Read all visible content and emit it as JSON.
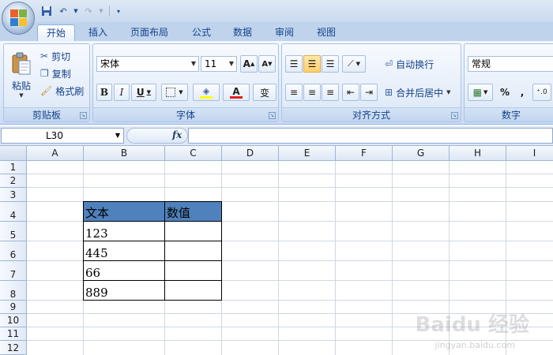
{
  "tabs": [
    "开始",
    "插入",
    "页面布局",
    "公式",
    "数据",
    "审阅",
    "视图"
  ],
  "clipboard": {
    "paste": "粘贴",
    "cut": "剪切",
    "copy": "复制",
    "format_painter": "格式刷",
    "group_label": "剪贴板"
  },
  "font": {
    "name": "宋体",
    "size": "11",
    "group_label": "字体"
  },
  "alignment": {
    "wrap_text": "自动换行",
    "merge_center": "合并后居中",
    "group_label": "对齐方式"
  },
  "number": {
    "format": "常规",
    "group_label": "数字"
  },
  "formula_bar": {
    "name_box": "L30",
    "fx": "fx"
  },
  "sheet": {
    "columns": [
      "A",
      "B",
      "C",
      "D",
      "E",
      "F",
      "G",
      "H",
      "I"
    ],
    "rows": [
      "1",
      "2",
      "3",
      "4",
      "5",
      "6",
      "7",
      "8",
      "9",
      "10",
      "11",
      "12"
    ],
    "table": {
      "header": [
        "文本",
        "数值"
      ],
      "values": [
        "123",
        "445",
        "66",
        "889"
      ]
    }
  },
  "watermark": {
    "brand": "Baidu 经验",
    "url": "jingyan.baidu.com"
  },
  "colors": {
    "header_fill": "#4f81bd",
    "ribbon_bg": "#dfe9f7"
  }
}
